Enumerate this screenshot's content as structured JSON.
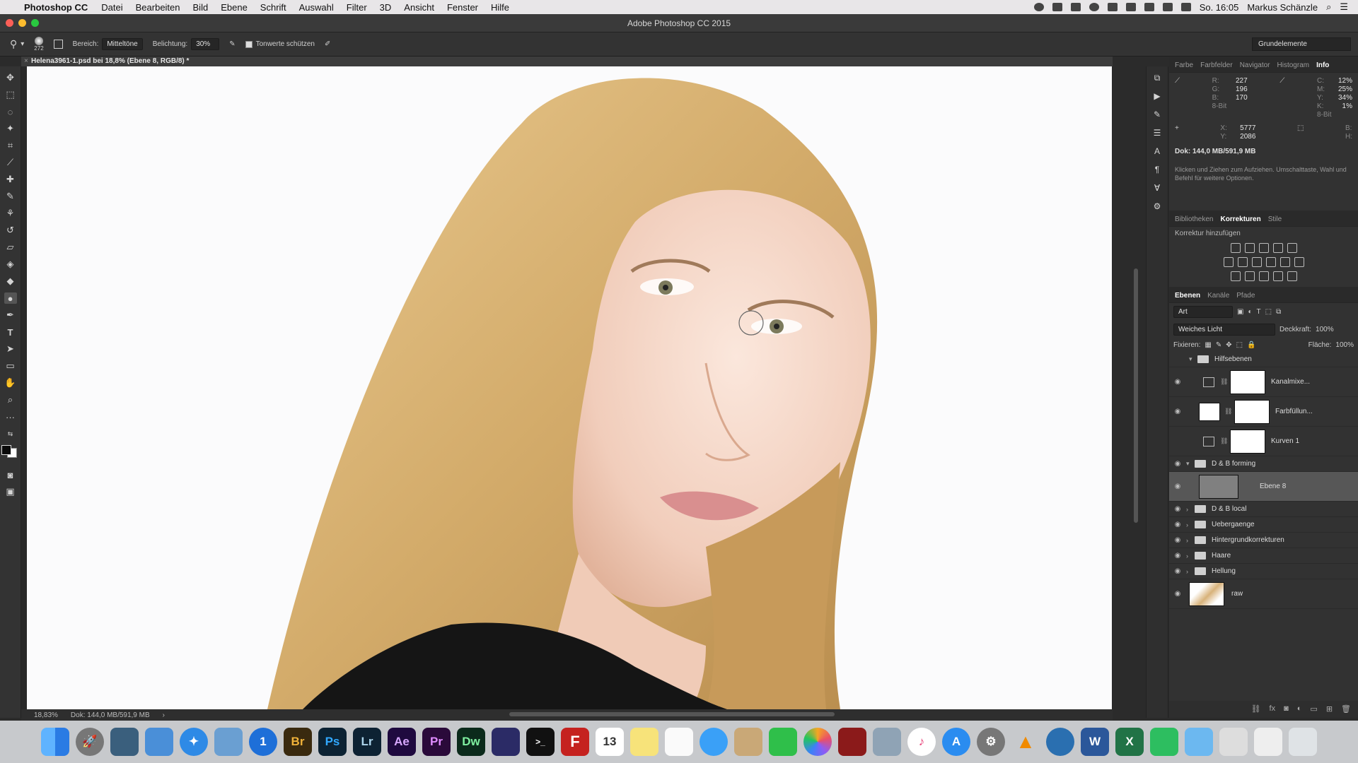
{
  "menubar": {
    "app_name": "Photoshop CC",
    "items": [
      "Datei",
      "Bearbeiten",
      "Bild",
      "Ebene",
      "Schrift",
      "Auswahl",
      "Filter",
      "3D",
      "Ansicht",
      "Fenster",
      "Hilfe"
    ],
    "clock": "So. 16:05",
    "user": "Markus Schänzle"
  },
  "window": {
    "title": "Adobe Photoshop CC 2015"
  },
  "options": {
    "brush_size": "272",
    "range_label": "Bereich:",
    "range_value": "Mitteltöne",
    "exposure_label": "Belichtung:",
    "exposure_value": "30%",
    "protect_tones_label": "Tonwerte schützen",
    "workspace": "Grundelemente"
  },
  "document": {
    "tab_title": "Helena3961-1.psd bei 18,8% (Ebene 8, RGB/8) *",
    "zoom": "18,83%",
    "doc_size": "Dok: 144,0 MB/591,9 MB"
  },
  "info_panel": {
    "tabs": [
      "Farbe",
      "Farbfelder",
      "Navigator",
      "Histogram",
      "Info"
    ],
    "active_tab": "Info",
    "rgb": {
      "R": "227",
      "G": "196",
      "B": "170"
    },
    "cmyk": {
      "C": "12%",
      "M": "25%",
      "Y": "34%",
      "K": "1%"
    },
    "bit_left": "8-Bit",
    "bit_right": "8-Bit",
    "x": "5777",
    "y": "2086",
    "b_label": "B:",
    "h_label": "H:",
    "doc": "Dok: 144,0 MB/591,9 MB",
    "hint": "Klicken und Ziehen zum Aufziehen. Umschalttaste, Wahl und Befehl für weitere Optionen."
  },
  "adjustments_panel": {
    "tabs": [
      "Bibliotheken",
      "Korrekturen",
      "Stile"
    ],
    "active_tab": "Korrekturen",
    "title": "Korrektur hinzufügen"
  },
  "layers_panel": {
    "tabs": [
      "Ebenen",
      "Kanäle",
      "Pfade"
    ],
    "active_tab": "Ebenen",
    "filter": "Art",
    "blend_mode": "Weiches Licht",
    "opacity_label": "Deckkraft:",
    "opacity": "100%",
    "lock_label": "Fixieren:",
    "fill_label": "Fläche:",
    "fill": "100%",
    "layers": [
      {
        "name": "Hilfsebenen",
        "kind": "group",
        "visible": false
      },
      {
        "name": "Kanalmixe...",
        "kind": "adjustment",
        "visible": false
      },
      {
        "name": "Farbfüllun...",
        "kind": "fill",
        "visible": false
      },
      {
        "name": "Kurven 1",
        "kind": "adjustment",
        "visible": false
      },
      {
        "name": "D & B forming",
        "kind": "group",
        "visible": true
      },
      {
        "name": "Ebene 8",
        "kind": "pixel",
        "visible": true,
        "selected": true
      },
      {
        "name": "D & B local",
        "kind": "group",
        "visible": true
      },
      {
        "name": "Uebergaenge",
        "kind": "group",
        "visible": true
      },
      {
        "name": "Hintergrundkorrekturen",
        "kind": "group",
        "visible": true
      },
      {
        "name": "Haare",
        "kind": "group",
        "visible": true
      },
      {
        "name": "Hellung",
        "kind": "group",
        "visible": true
      },
      {
        "name": "raw",
        "kind": "image",
        "visible": true
      }
    ]
  },
  "dock": {
    "apps": [
      "Br",
      "Ps",
      "Lr",
      "Ae",
      "Pr",
      "Dw",
      "W",
      "X"
    ]
  },
  "colors": {
    "accent": "#31a8ff",
    "panel_bg": "#323232",
    "canvas_bg": "#fbfbfc"
  }
}
